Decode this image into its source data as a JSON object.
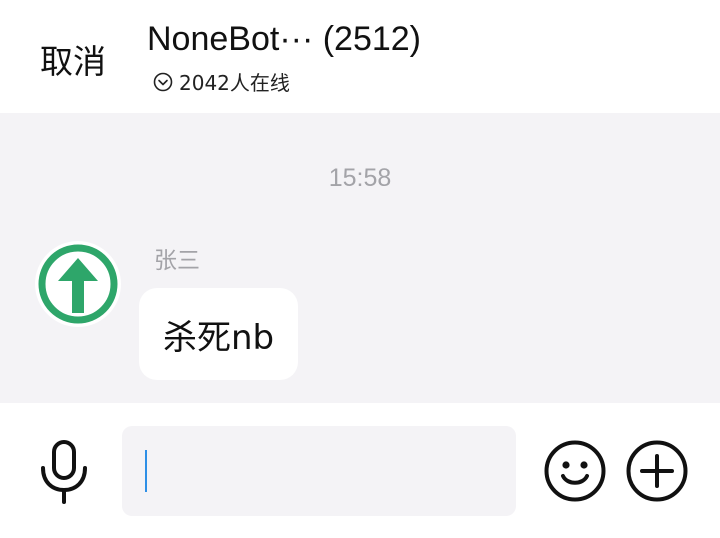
{
  "header": {
    "cancel_label": "取消",
    "title": "NoneBot··· (2512)",
    "online_text": "2042人在线"
  },
  "chat": {
    "timestamp": "15:58",
    "messages": [
      {
        "sender": "张三",
        "text": "杀死nb",
        "avatar_icon": "green-up-arrow-icon"
      }
    ]
  },
  "input": {
    "value": "",
    "placeholder": ""
  },
  "colors": {
    "chat_background": "#f4f3f6",
    "avatar_green": "#2ea66a",
    "caret_blue": "#2e8fe6",
    "muted_text": "#a3a3a8"
  }
}
